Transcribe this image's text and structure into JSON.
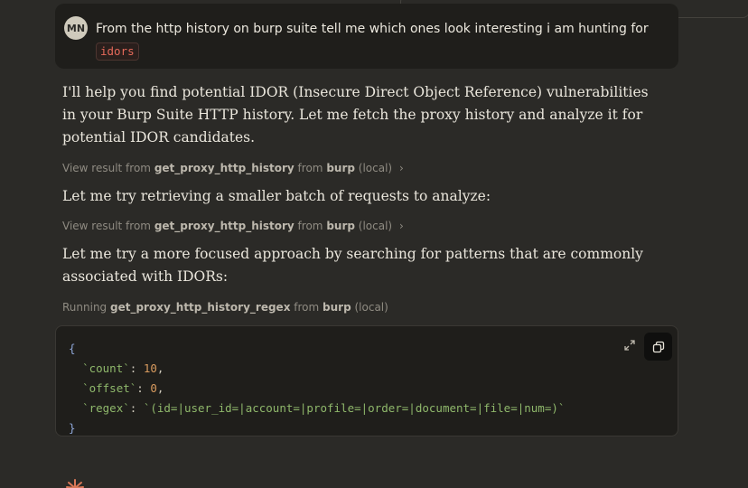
{
  "user_message": {
    "initials": "MN",
    "text": "From the http history on burp suite tell me which ones look interesting i am hunting for",
    "code": "idors"
  },
  "paragraphs": [
    "I'll help you find potential IDOR (Insecure Direct Object Reference) vulnerabilities in your Burp Suite HTTP history. Let me fetch the proxy history and analyze it for potential IDOR candidates.",
    "Let me try retrieving a smaller batch of requests to analyze:",
    "Let me try a more focused approach by searching for patterns that are commonly associated with IDORs:"
  ],
  "tool_calls": [
    {
      "prefix": "View result from",
      "tool": "get_proxy_http_history",
      "from": "from",
      "server": "burp",
      "scope": "(local)"
    },
    {
      "prefix": "View result from",
      "tool": "get_proxy_http_history",
      "from": "from",
      "server": "burp",
      "scope": "(local)"
    },
    {
      "prefix": "Running",
      "tool": "get_proxy_http_history_regex",
      "from": "from",
      "server": "burp",
      "scope": "(local)"
    }
  ],
  "code_block": {
    "open": "{",
    "close": "}",
    "fields": [
      {
        "key": "`count`",
        "sep": ": ",
        "value": "10",
        "trail": ","
      },
      {
        "key": "`offset`",
        "sep": ": ",
        "value": "0",
        "trail": ","
      },
      {
        "key": "`regex`",
        "sep": ": ",
        "value": "`(id=|user_id=|account=|profile=|order=|document=|file=|num=)`",
        "trail": ""
      }
    ]
  },
  "icons": {
    "avatar": "user-avatar",
    "expand": "expand-icon",
    "copy": "copy-icon",
    "chevron": "chevron-right-icon",
    "assistant": "sparkle-icon"
  },
  "colors": {
    "background": "#2b2a27",
    "panel": "#1f1e1b",
    "inline_code": "#e5695a",
    "accent_orange": "#d97757"
  }
}
